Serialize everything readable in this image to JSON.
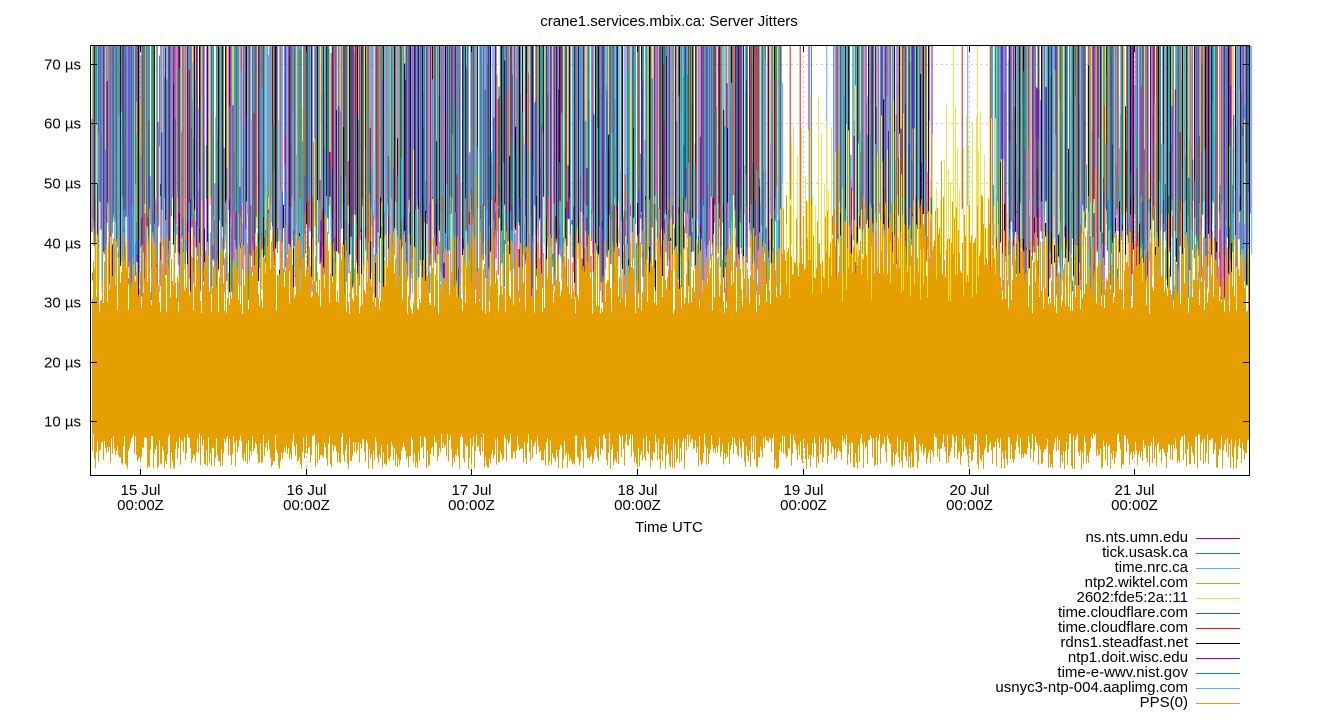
{
  "chart_data": {
    "type": "line",
    "title": "crane1.services.mbix.ca: Server Jitters",
    "xlabel": "Time UTC",
    "ylabel": "",
    "ylim": [
      1,
      73
    ],
    "xlim_days": "2024-07-14T17:00Z to 2024-07-21T19:00Z",
    "grid": true,
    "legend_placement": "bottom-right",
    "y_ticks": [
      {
        "value": 10,
        "label": "10 µs"
      },
      {
        "value": 20,
        "label": "20 µs"
      },
      {
        "value": 30,
        "label": "30 µs"
      },
      {
        "value": 40,
        "label": "40 µs"
      },
      {
        "value": 50,
        "label": "50 µs"
      },
      {
        "value": 60,
        "label": "60 µs"
      },
      {
        "value": 70,
        "label": "70 µs"
      }
    ],
    "x_ticks": [
      {
        "day": "15 Jul",
        "time": "00:00Z"
      },
      {
        "day": "16 Jul",
        "time": "00:00Z"
      },
      {
        "day": "17 Jul",
        "time": "00:00Z"
      },
      {
        "day": "18 Jul",
        "time": "00:00Z"
      },
      {
        "day": "19 Jul",
        "time": "00:00Z"
      },
      {
        "day": "20 Jul",
        "time": "00:00Z"
      },
      {
        "day": "21 Jul",
        "time": "00:00Z"
      }
    ],
    "series": [
      {
        "name": "ns.nts.umn.edu",
        "color": "#9400d3",
        "typical_range_us": [
          30,
          73
        ]
      },
      {
        "name": "tick.usask.ca",
        "color": "#009e73",
        "typical_range_us": [
          30,
          73
        ]
      },
      {
        "name": "time.nrc.ca",
        "color": "#56b4e9",
        "typical_range_us": [
          30,
          73
        ]
      },
      {
        "name": "ntp2.wiktel.com",
        "color": "#e69f00",
        "typical_range_us": [
          30,
          73
        ]
      },
      {
        "name": "2602:fde5:2a::11",
        "color": "#f0e442",
        "typical_range_us": [
          30,
          73
        ]
      },
      {
        "name": "time.cloudflare.com",
        "color": "#0072b2",
        "typical_range_us": [
          30,
          73
        ]
      },
      {
        "name": "time.cloudflare.com",
        "color": "#e51e10",
        "typical_range_us": [
          30,
          73
        ]
      },
      {
        "name": "rdns1.steadfast.net",
        "color": "#000000",
        "typical_range_us": [
          30,
          73
        ]
      },
      {
        "name": "ntp1.doit.wisc.edu",
        "color": "#9400d3",
        "typical_range_us": [
          30,
          73
        ]
      },
      {
        "name": "time-e-wwv.nist.gov",
        "color": "#009e73",
        "typical_range_us": [
          30,
          73
        ]
      },
      {
        "name": "usnyc3-ntp-004.aaplimg.com",
        "color": "#56b4e9",
        "typical_range_us": [
          30,
          73
        ]
      },
      {
        "name": "PPS(0)",
        "color": "#e69f00",
        "typical_range_us": [
          2,
          40
        ]
      }
    ]
  }
}
